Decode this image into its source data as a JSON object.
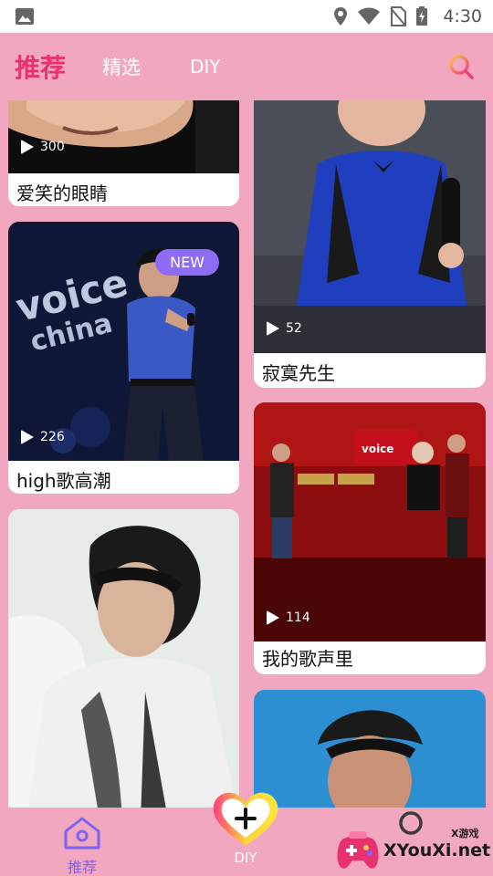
{
  "status_bar": {
    "time": "4:30"
  },
  "top_nav": {
    "tabs": [
      {
        "label": "推荐",
        "active": true
      },
      {
        "label": "精选",
        "active": false
      },
      {
        "label": "DIY",
        "active": false
      }
    ],
    "search_icon": "search-icon"
  },
  "feed": {
    "cards": [
      {
        "title": "爱笑的眼睛",
        "plays": "300"
      },
      {
        "title": "寂寞先生",
        "plays": "52"
      },
      {
        "title": "high歌高潮",
        "plays": "226",
        "badge": "NEW"
      },
      {
        "title": "我的歌声里",
        "plays": "114"
      }
    ]
  },
  "bottom_nav": {
    "home_label": "推荐",
    "diy_label": "DIY"
  },
  "watermark": {
    "text": "XYouXi.net",
    "small": "X游戏"
  },
  "colors": {
    "background": "#f2a7c0",
    "accent": "#e8326f",
    "nav_active": "#7b63f2",
    "badge": "#8f6cf5"
  }
}
